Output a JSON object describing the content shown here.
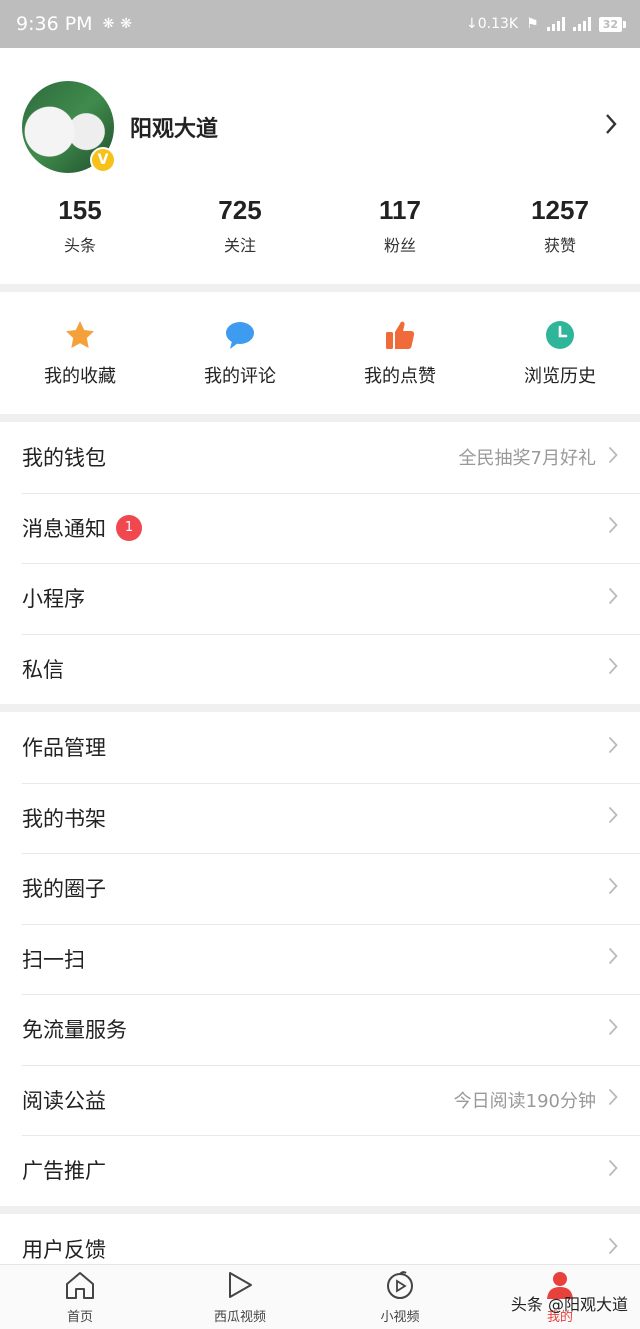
{
  "status_bar": {
    "time": "9:36 PM",
    "left_icons": [
      "china-unicom-icon",
      "china-unicom-icon"
    ],
    "net_speed": "↓0.13K",
    "network_type": "4G",
    "battery": "32"
  },
  "profile": {
    "name": "阳观大道",
    "verified_badge": "V",
    "stats": [
      {
        "value": "155",
        "label": "头条"
      },
      {
        "value": "725",
        "label": "关注"
      },
      {
        "value": "117",
        "label": "粉丝"
      },
      {
        "value": "1257",
        "label": "获赞"
      }
    ]
  },
  "quick_actions": [
    {
      "label": "我的收藏",
      "icon": "star-icon",
      "color": "#f5a13a"
    },
    {
      "label": "我的评论",
      "icon": "comment-icon",
      "color": "#3d9bf0"
    },
    {
      "label": "我的点赞",
      "icon": "thumbs-up-icon",
      "color": "#f06a3a"
    },
    {
      "label": "浏览历史",
      "icon": "clock-icon",
      "color": "#2fb59a"
    }
  ],
  "menu_group1": [
    {
      "label": "我的钱包",
      "sub": "全民抽奖7月好礼"
    },
    {
      "label": "消息通知",
      "badge": "1"
    },
    {
      "label": "小程序"
    },
    {
      "label": "私信"
    }
  ],
  "menu_group2": [
    {
      "label": "作品管理"
    },
    {
      "label": "我的书架"
    },
    {
      "label": "我的圈子"
    },
    {
      "label": "扫一扫"
    },
    {
      "label": "免流量服务"
    },
    {
      "label": "阅读公益",
      "sub": "今日阅读190分钟"
    },
    {
      "label": "广告推广"
    }
  ],
  "menu_group3": [
    {
      "label": "用户反馈"
    }
  ],
  "tabbar": [
    {
      "label": "首页",
      "icon": "home-icon"
    },
    {
      "label": "西瓜视频",
      "icon": "play-icon"
    },
    {
      "label": "小视频",
      "icon": "short-video-icon"
    },
    {
      "label": "我的",
      "icon": "person-icon",
      "active": true
    }
  ],
  "watermark": "头条 @阳观大道",
  "colors": {
    "accent_red": "#e8413b",
    "badge_gold": "#f6c21a",
    "notification_red": "#f0484e"
  }
}
